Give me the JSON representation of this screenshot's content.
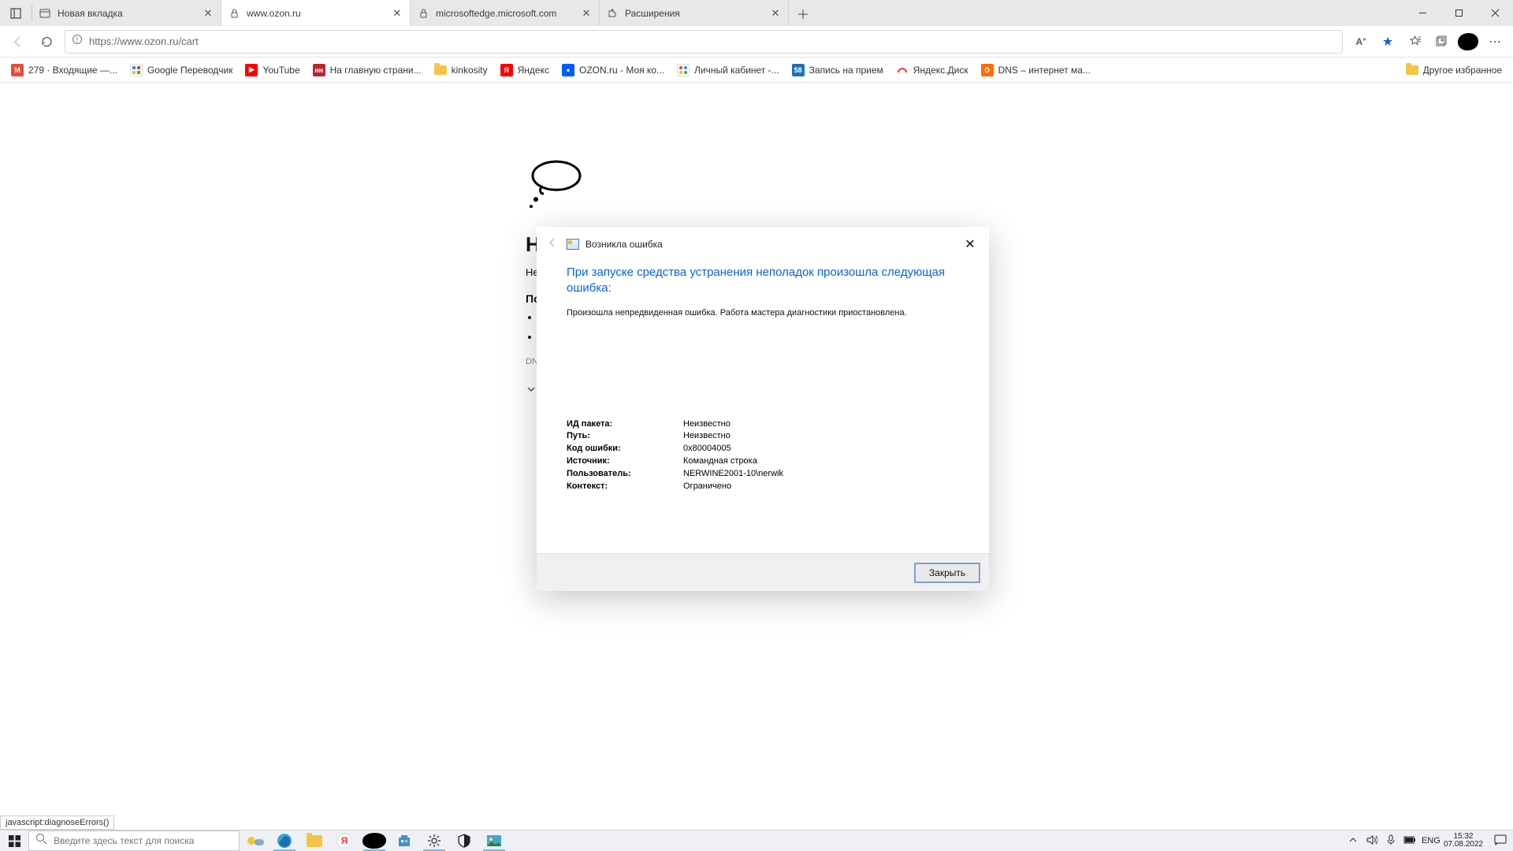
{
  "tabs": [
    {
      "title": "Новая вкладка"
    },
    {
      "title": "www.ozon.ru"
    },
    {
      "title": "microsoftedge.microsoft.com"
    },
    {
      "title": "Расширения"
    }
  ],
  "url": "https://www.ozon.ru/cart",
  "bookmarks": [
    {
      "label": "279 · Входящие —...",
      "color": "#e74c3c"
    },
    {
      "label": "Google Переводчик",
      "color": "#4285f4"
    },
    {
      "label": "YouTube",
      "color": "#ff0000"
    },
    {
      "label": "На главную страни...",
      "color": "#c0232b"
    },
    {
      "label": "kinkosity",
      "color": "#f6c445",
      "folder": true
    },
    {
      "label": "Яндекс",
      "color": "#ff0000"
    },
    {
      "label": "OZON.ru - Моя ко...",
      "color": "#005bff"
    },
    {
      "label": "Личный кабинет -...",
      "color": "#1c9b4a"
    },
    {
      "label": "Запись на прием",
      "color": "#1c73b7"
    },
    {
      "label": "Яндекс.Диск",
      "color": "#ffcc00"
    },
    {
      "label": "DNS – интернет ма...",
      "color": "#ff6b00"
    }
  ],
  "bookmarks_more": "Другое избранное",
  "page": {
    "h": "Н",
    "p1": "Не",
    "p2": "По",
    "dns": "DN"
  },
  "status_tip": "javascript:diagnoseErrors()",
  "dialog": {
    "title": "Возникла ошибка",
    "heading": "При запуске средства устранения неполадок произошла следующая ошибка:",
    "desc": "Произошла непредвиденная ошибка. Работа мастера диагностики приостановлена.",
    "rows": [
      {
        "k": "ИД пакета:",
        "v": "Неизвестно"
      },
      {
        "k": "Путь:",
        "v": "Неизвестно"
      },
      {
        "k": "Код ошибки:",
        "v": "0x80004005"
      },
      {
        "k": "Источник:",
        "v": "Командная строка"
      },
      {
        "k": "Пользователь:",
        "v": "NERWINE2001-10\\nerwik"
      },
      {
        "k": "Контекст:",
        "v": "Ограничено"
      }
    ],
    "close_btn": "Закрыть"
  },
  "taskbar": {
    "search_placeholder": "Введите здесь текст для поиска",
    "lang": "ENG",
    "time": "15:32",
    "date": "07.08.2022"
  }
}
